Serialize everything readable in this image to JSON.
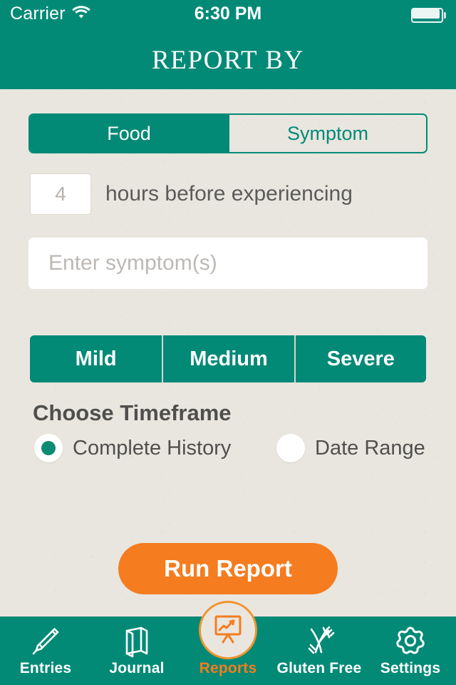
{
  "status_bar": {
    "carrier": "Carrier",
    "wifi_icon": "wifi-icon",
    "time": "6:30 PM",
    "battery_icon": "battery-icon"
  },
  "navbar": {
    "title": "REPORT BY"
  },
  "colors": {
    "teal": "#028a77",
    "orange": "#f57c1f",
    "badge_orange": "#f0952e",
    "paper": "#e9e6df",
    "text_dark": "#4f4f4d",
    "placeholder": "#bcb9b4"
  },
  "report_type": {
    "options": [
      {
        "label": "Food",
        "selected": true
      },
      {
        "label": "Symptom",
        "selected": false
      }
    ]
  },
  "hours": {
    "value": "",
    "placeholder": "4",
    "label": "hours before experiencing"
  },
  "symptom_input": {
    "value": "",
    "placeholder": "Enter symptom(s)"
  },
  "severity": {
    "options": [
      {
        "label": "Mild"
      },
      {
        "label": "Medium"
      },
      {
        "label": "Severe"
      }
    ]
  },
  "timeframe": {
    "heading": "Choose Timeframe",
    "options": [
      {
        "label": "Complete History",
        "selected": true
      },
      {
        "label": "Date Range",
        "selected": false
      }
    ]
  },
  "actions": {
    "run_report": "Run Report"
  },
  "tabbar": {
    "items": [
      {
        "label": "Entries",
        "icon": "pen-icon",
        "active": false
      },
      {
        "label": "Journal",
        "icon": "book-icon",
        "active": false
      },
      {
        "label": "Reports",
        "icon": "chart-presentation-icon",
        "active": true
      },
      {
        "label": "Gluten Free",
        "icon": "wheat-crossed-icon",
        "active": false
      },
      {
        "label": "Settings",
        "icon": "gear-icon",
        "active": false
      }
    ]
  }
}
